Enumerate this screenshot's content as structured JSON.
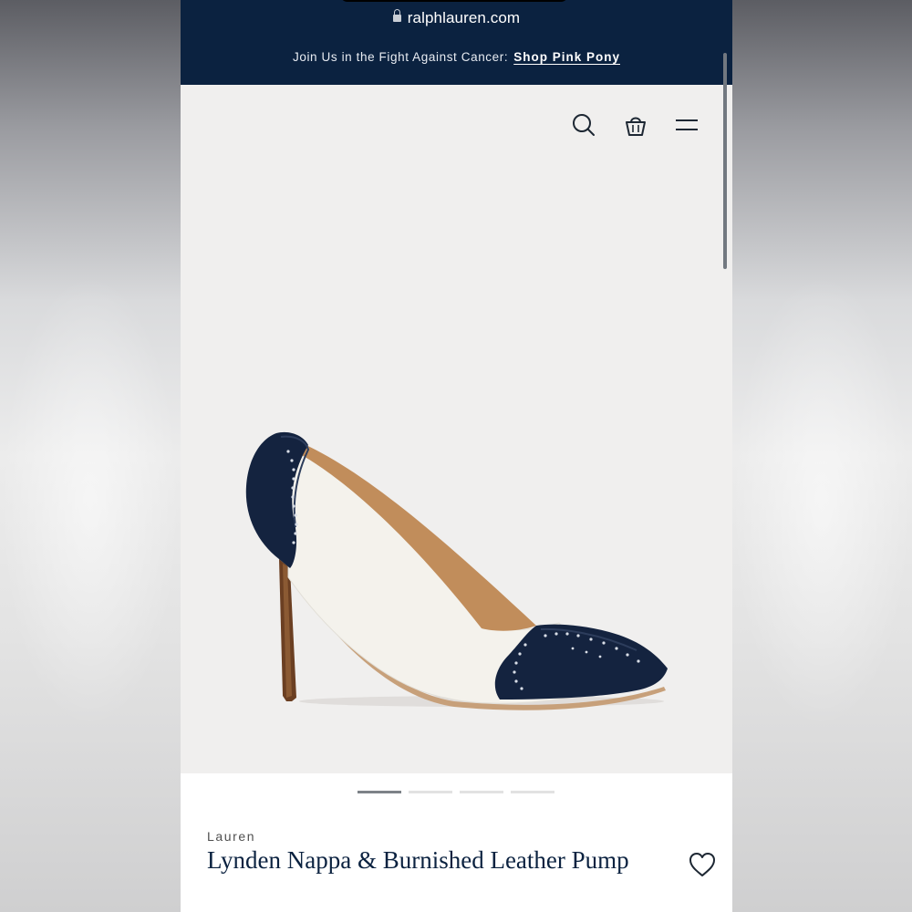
{
  "browser": {
    "url": "ralphlauren.com"
  },
  "promo": {
    "text": "Join Us in the Fight Against Cancer:",
    "link_label": "Shop Pink Pony"
  },
  "header": {
    "icons": [
      "search-icon",
      "shopping-bag-icon",
      "menu-icon"
    ]
  },
  "gallery": {
    "image_description_icon": "pump-shoe-image",
    "slide_count": 4,
    "active_slide": 1
  },
  "product": {
    "brand": "Lauren",
    "title": "Lynden Nappa & Burnished Leather Pump"
  },
  "colors": {
    "navy": "#0b2240",
    "ivory": "#f3f1ea",
    "background": "#f0efee"
  }
}
